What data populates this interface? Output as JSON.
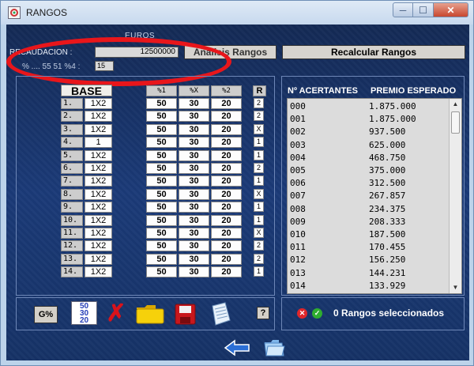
{
  "window": {
    "title": "RANGOS"
  },
  "controls": {
    "min": "─",
    "max": "☐",
    "close": "✕"
  },
  "header": {
    "currency": "EUROS",
    "recaudacion_label": "RECAUDACION :",
    "recaudacion_value": "12500000",
    "second_label": "% .... 55 51 %4 :",
    "second_value": "15",
    "analisis_label": "Análisis Rangos",
    "recalcular_label": "Recalcular Rangos"
  },
  "base": {
    "title": "BASE",
    "rows": [
      {
        "n": "1.",
        "s": "1X2"
      },
      {
        "n": "2.",
        "s": "1X2"
      },
      {
        "n": "3.",
        "s": "1X2"
      },
      {
        "n": "4.",
        "s": "1"
      },
      {
        "n": "5.",
        "s": "1X2"
      },
      {
        "n": "6.",
        "s": "1X2"
      },
      {
        "n": "7.",
        "s": "1X2"
      },
      {
        "n": "8.",
        "s": "1X2"
      },
      {
        "n": "9.",
        "s": "1X2"
      },
      {
        "n": "10.",
        "s": "1X2"
      },
      {
        "n": "11.",
        "s": "1X2"
      },
      {
        "n": "12.",
        "s": "1X2"
      },
      {
        "n": "13.",
        "s": "1X2"
      },
      {
        "n": "14.",
        "s": "1X2"
      }
    ]
  },
  "percent": {
    "headers": [
      "%1",
      "%X",
      "%2"
    ],
    "row": [
      "50",
      "30",
      "20"
    ]
  },
  "r_column": {
    "header": "R",
    "values": [
      "2",
      "2",
      "X",
      "1",
      "1",
      "2",
      "1",
      "X",
      "1",
      "1",
      "X",
      "2",
      "2",
      "1"
    ]
  },
  "results": {
    "col1_header": "Nº ACERTANTES",
    "col2_header": "PREMIO ESPERADO",
    "rows": [
      {
        "c": "000",
        "p": "1.875.000"
      },
      {
        "c": "001",
        "p": "1.875.000"
      },
      {
        "c": "002",
        "p": "937.500"
      },
      {
        "c": "003",
        "p": "625.000"
      },
      {
        "c": "004",
        "p": "468.750"
      },
      {
        "c": "005",
        "p": "375.000"
      },
      {
        "c": "006",
        "p": "312.500"
      },
      {
        "c": "007",
        "p": "267.857"
      },
      {
        "c": "008",
        "p": "234.375"
      },
      {
        "c": "009",
        "p": "208.333"
      },
      {
        "c": "010",
        "p": "187.500"
      },
      {
        "c": "011",
        "p": "170.455"
      },
      {
        "c": "012",
        "p": "156.250"
      },
      {
        "c": "013",
        "p": "144.231"
      },
      {
        "c": "014",
        "p": "133.929"
      }
    ]
  },
  "toolbar": {
    "gpct_label": "G%",
    "pct_icon_lines": [
      "50",
      "30",
      "20"
    ],
    "x_label": "✗",
    "help_label": "?"
  },
  "status": {
    "red_glyph": "✕",
    "green_glyph": "✓",
    "text": "0 Rangos seleccionados"
  },
  "colors": {
    "background": "#1b3a78",
    "highlight_ellipse": "#e8161b",
    "delete_red": "#d8131b"
  },
  "icons": [
    "app-icon",
    "delete-icon",
    "folder-icon",
    "save-disk-icon",
    "notepad-icon",
    "back-arrow-icon",
    "open-folder-icon"
  ]
}
